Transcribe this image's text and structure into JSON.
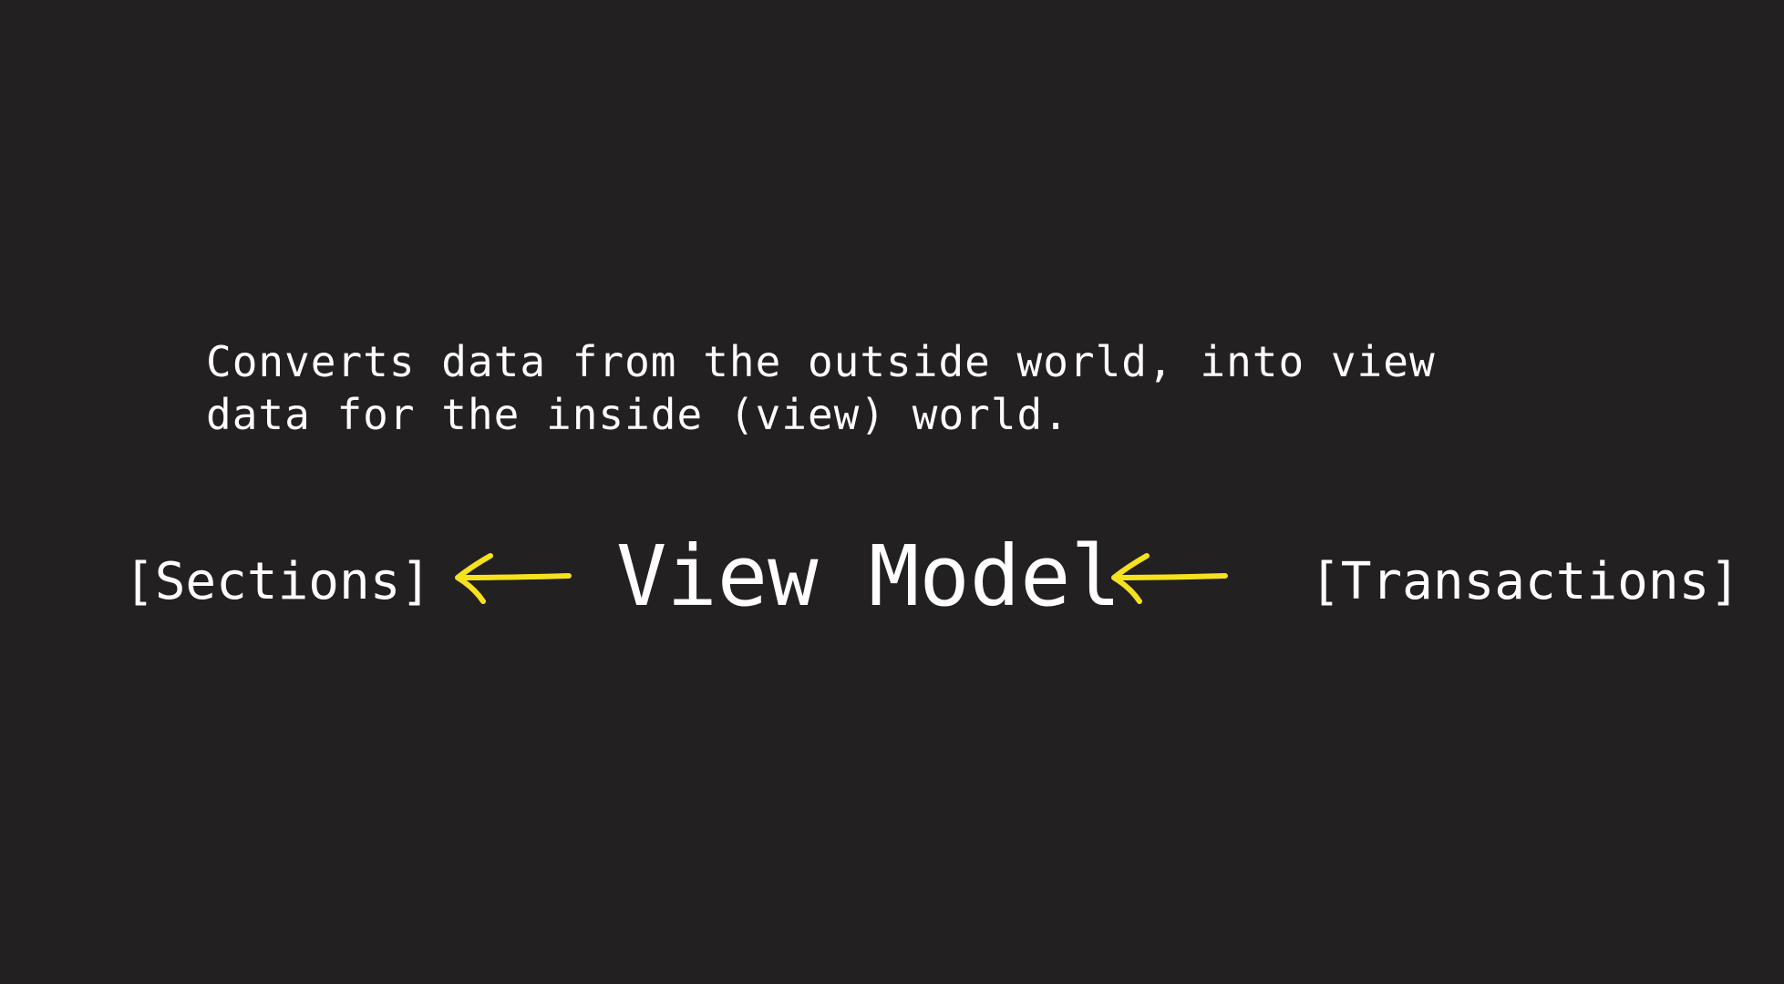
{
  "description": {
    "line1": "Converts data from the outside world, into view",
    "line2": "data for the inside (view) world."
  },
  "diagram": {
    "left_label": "[Sections]",
    "center_label": "View Model",
    "right_label": "[Transactions]",
    "arrow_color": "#f5e11e",
    "background": "#232021",
    "text_color": "#ffffff"
  }
}
